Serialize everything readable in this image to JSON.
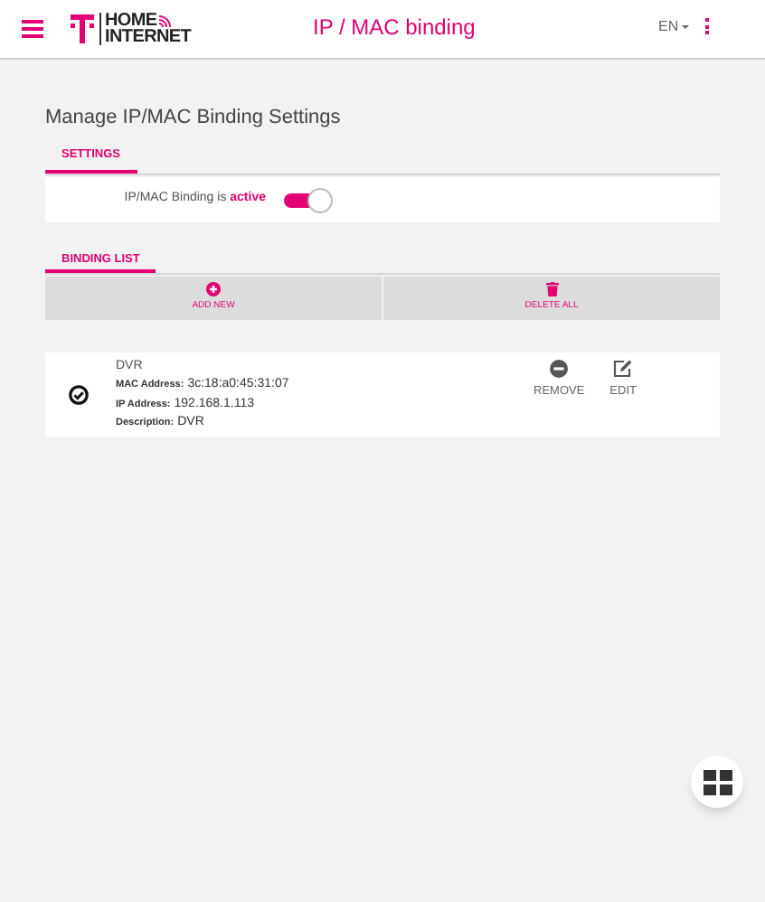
{
  "header": {
    "logo_lines": [
      "HOME",
      "INTERNET"
    ],
    "title": "IP / MAC binding",
    "language": "EN"
  },
  "page_title": "Manage IP/MAC Binding Settings",
  "settings_tabs": [
    {
      "label": "SETTINGS",
      "selected": true
    }
  ],
  "binding_toggle": {
    "label": "IP/MAC Binding is **active**",
    "on": true
  },
  "list_tabs": [
    {
      "label": "BINDING LIST",
      "selected": true
    }
  ],
  "list_actions": [
    {
      "kind": "add",
      "label": "ADD NEW"
    },
    {
      "kind": "delete",
      "label": "DELETE ALL"
    }
  ],
  "entries": [
    {
      "name": "DVR",
      "checked": true,
      "fields": [
        {
          "label": "MAC Address:",
          "value": "3c:18:a0:45:31:07"
        },
        {
          "label": "IP Address:",
          "value": "192.168.1.113"
        },
        {
          "label": "Description:",
          "value": "DVR"
        }
      ],
      "actions": [
        {
          "kind": "remove",
          "label": "REMOVE"
        },
        {
          "kind": "edit",
          "label": "EDIT"
        }
      ]
    }
  ]
}
